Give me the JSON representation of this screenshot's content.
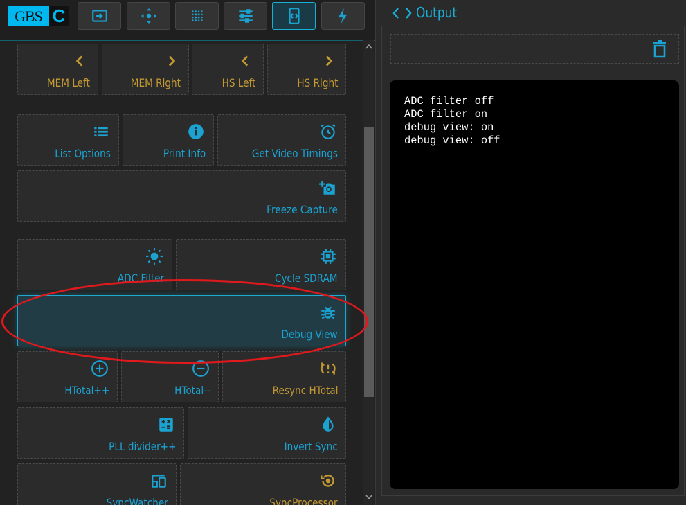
{
  "logo": {
    "left": "GBS",
    "right": "C"
  },
  "nav_tabs": [
    {
      "name": "input-icon"
    },
    {
      "name": "move-icon"
    },
    {
      "name": "filter-dots-icon"
    },
    {
      "name": "sliders-icon"
    },
    {
      "name": "code-icon"
    },
    {
      "name": "bolt-icon"
    }
  ],
  "buttons": {
    "mem_left": "MEM Left",
    "mem_right": "MEM Right",
    "hs_left": "HS Left",
    "hs_right": "HS Right",
    "list_options": "List Options",
    "print_info": "Print Info",
    "get_video_timings": "Get Video Timings",
    "freeze_capture": "Freeze Capture",
    "adc_filter": "ADC Filter",
    "cycle_sdram": "Cycle SDRAM",
    "debug_view": "Debug View",
    "htotal_plus": "HTotal++",
    "htotal_minus": "HTotal--",
    "resync_htotal": "Resync HTotal",
    "pll_divider": "PLL divider++",
    "invert_sync": "Invert Sync",
    "syncwatcher": "SyncWatcher",
    "syncprocessor": "SyncProcessor"
  },
  "output": {
    "title": "Output",
    "lines": [
      "ADC filter off",
      "ADC filter on",
      "debug view: on",
      "debug view: off"
    ]
  },
  "colors": {
    "accent": "#19b0d8",
    "gold": "#c39934",
    "annotation": "#e0191d"
  }
}
